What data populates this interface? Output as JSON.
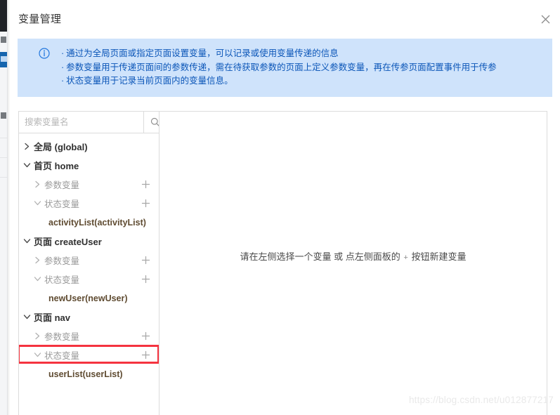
{
  "window": {
    "title": "变量管理",
    "close_icon": "close-icon"
  },
  "info_banner": {
    "icon": "info-circle-icon",
    "accent_color": "#0b56b8",
    "background_color": "#cfe3fb",
    "lines": [
      "通过为全局页面或指定页面设置变量，可以记录或使用变量传递的信息",
      "参数变量用于传递页面间的参数传递，需在待获取参数的页面上定义参数变量，再在传参页面配置事件用于传参",
      "状态变量用于记录当前页面内的变量信息。"
    ]
  },
  "search": {
    "placeholder": "搜索变量名",
    "value": "",
    "icon": "search-icon"
  },
  "tree": {
    "add_icon": "plus-icon",
    "chevron_collapsed_icon": "chevron-right-icon",
    "chevron_expanded_icon": "chevron-down-icon",
    "variable_color": "#5f4b31",
    "highlight_color": "#f5333f",
    "nodes": [
      {
        "label": "全局 (global)",
        "level": 1,
        "expanded": false,
        "has_add": false,
        "highlighted": false
      },
      {
        "label": "首页 home",
        "level": 1,
        "expanded": true,
        "has_add": false,
        "highlighted": false
      },
      {
        "label": "参数变量",
        "level": 2,
        "expanded": false,
        "has_add": true,
        "highlighted": false
      },
      {
        "label": "状态变量",
        "level": 2,
        "expanded": true,
        "has_add": true,
        "highlighted": false
      },
      {
        "label": "activityList(activityList)",
        "level": 3,
        "expanded": null,
        "has_add": false,
        "highlighted": false
      },
      {
        "label": "页面 createUser",
        "level": 1,
        "expanded": true,
        "has_add": false,
        "highlighted": false
      },
      {
        "label": "参数变量",
        "level": 2,
        "expanded": false,
        "has_add": true,
        "highlighted": false
      },
      {
        "label": "状态变量",
        "level": 2,
        "expanded": true,
        "has_add": true,
        "highlighted": false
      },
      {
        "label": "newUser(newUser)",
        "level": 3,
        "expanded": null,
        "has_add": false,
        "highlighted": false
      },
      {
        "label": "页面 nav",
        "level": 1,
        "expanded": true,
        "has_add": false,
        "highlighted": false
      },
      {
        "label": "参数变量",
        "level": 2,
        "expanded": false,
        "has_add": true,
        "highlighted": false
      },
      {
        "label": "状态变量",
        "level": 2,
        "expanded": true,
        "has_add": true,
        "highlighted": true
      },
      {
        "label": "userList(userList)",
        "level": 3,
        "expanded": null,
        "has_add": false,
        "highlighted": false
      }
    ]
  },
  "content": {
    "empty_state_part1": "请在左侧选择一个变量 或 点左侧面板的",
    "empty_state_plus": "+",
    "empty_state_part2": "按钮新建变量"
  },
  "watermark": {
    "text": "https://blog.csdn.net/u012877217"
  }
}
